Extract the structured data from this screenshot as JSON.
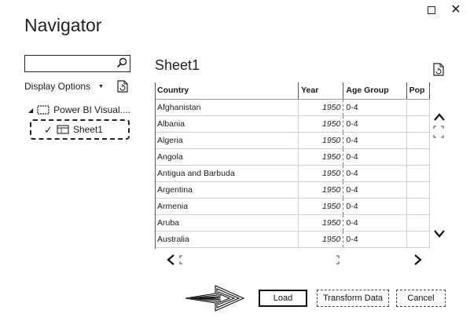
{
  "window": {
    "title": "Navigator",
    "maximize_icon": "maximize-icon",
    "close_glyph": "✕"
  },
  "left_panel": {
    "search": {
      "value": "",
      "placeholder": ""
    },
    "display_options_label": "Display Options",
    "tree": {
      "root_label": "Power BI Visual....",
      "child_label": "Sheet1",
      "child_checked": true
    }
  },
  "preview": {
    "title": "Sheet1",
    "columns": [
      "Country",
      "Year",
      "Age Group",
      "Pop"
    ],
    "rows": [
      [
        "Afghanistan",
        "1950",
        "0-4"
      ],
      [
        "Albania",
        "1950",
        "0-4"
      ],
      [
        "Algeria",
        "1950",
        "0-4"
      ],
      [
        "Angola",
        "1950",
        "0-4"
      ],
      [
        "Antigua and Barbuda",
        "1950",
        "0-4"
      ],
      [
        "Argentina",
        "1950",
        "0-4"
      ],
      [
        "Armenia",
        "1950",
        "0-4"
      ],
      [
        "Aruba",
        "1950",
        "0-4"
      ],
      [
        "Australia",
        "1950",
        "0-4"
      ]
    ]
  },
  "footer": {
    "load_label": "Load",
    "transform_label": "Transform Data",
    "cancel_label": "Cancel"
  }
}
